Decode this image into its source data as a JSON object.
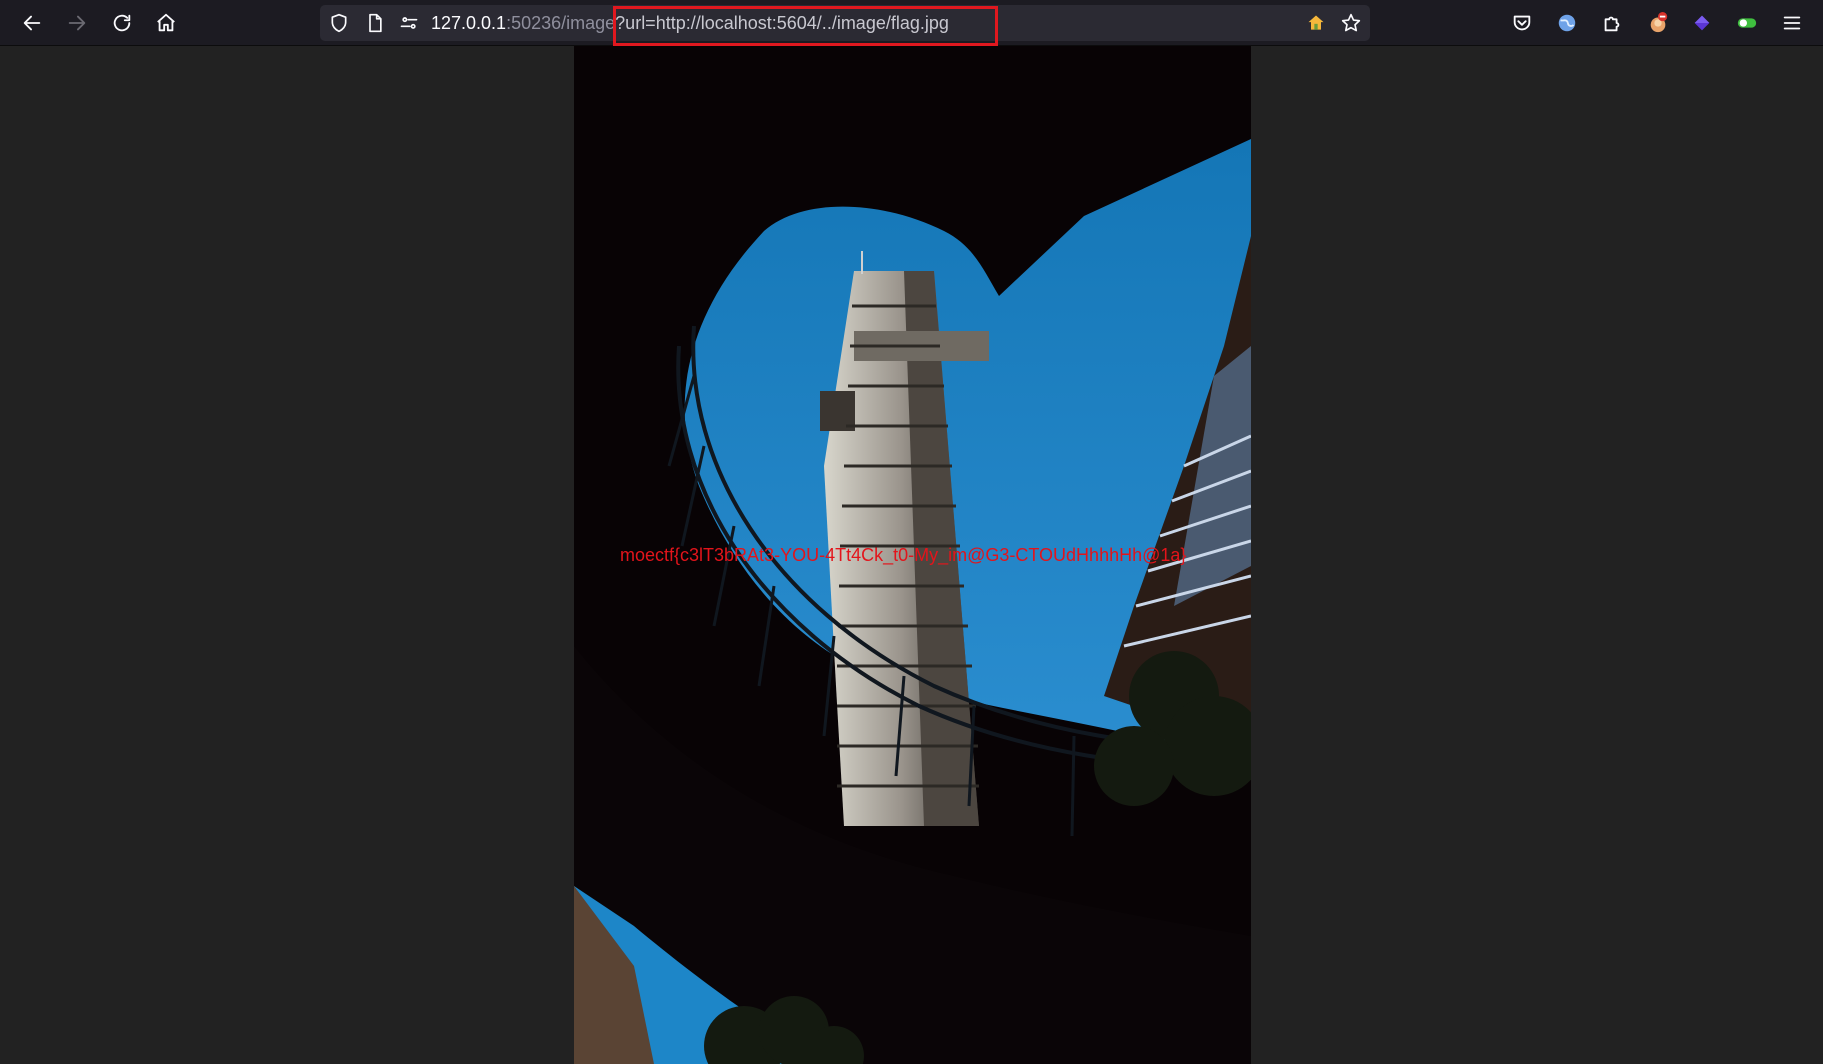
{
  "browser": {
    "url_host": "127.0.0.1",
    "url_port_path": ":50236/image",
    "url_query": "?url=http://localhost:5604/../image/flag.jpg",
    "nav": {
      "back_icon": "arrow-left-icon",
      "forward_icon": "arrow-right-icon",
      "reload_icon": "reload-icon",
      "home_icon": "home-icon"
    },
    "colors": {
      "toolbar": "#1c1b22",
      "urlbar": "#2b2a33",
      "highlight": "#e0181f"
    }
  },
  "page": {
    "flag_text": "moectf{c3lT3bRAt3-YOU-4Tt4Ck_t0-My_im@G3-CTOUdHhhhHh@1a}",
    "flag_color": "#e3141b",
    "background": "#222222"
  }
}
